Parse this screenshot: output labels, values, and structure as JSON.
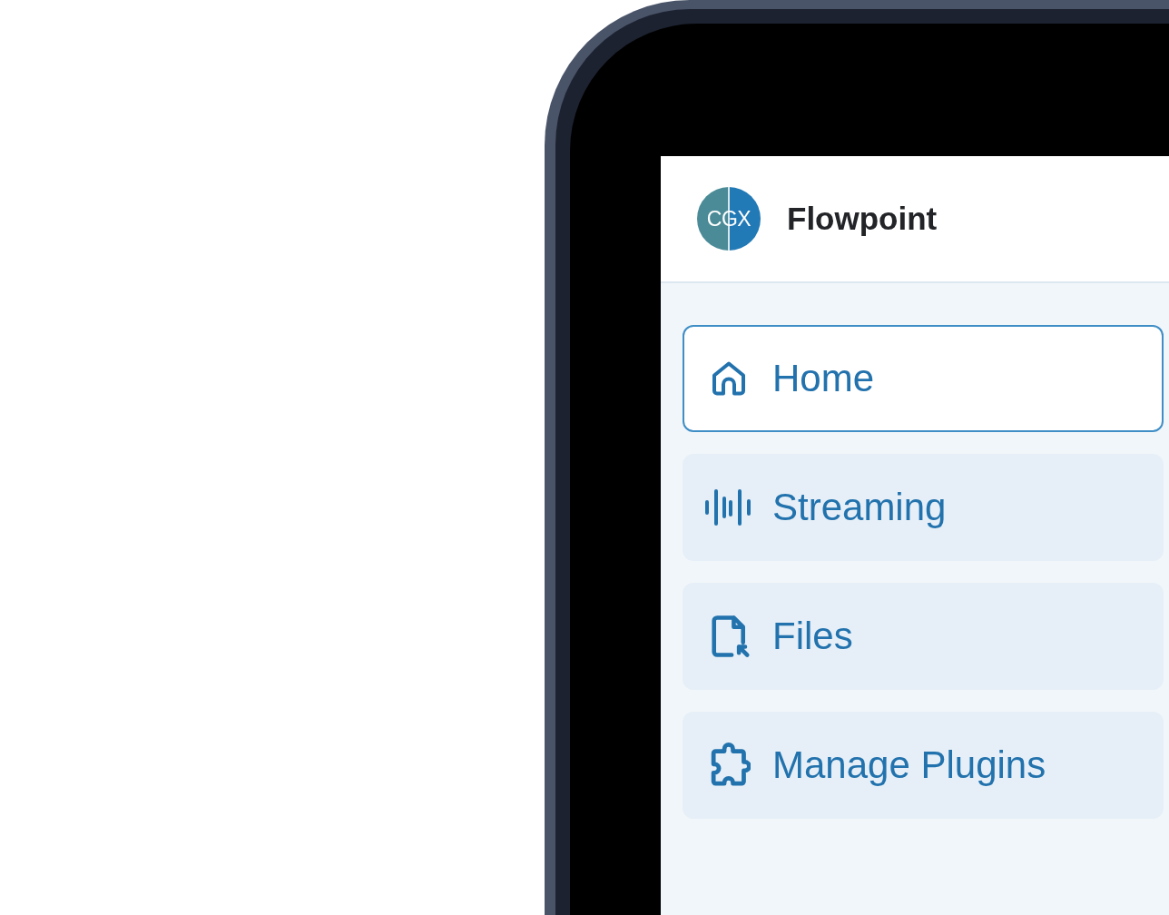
{
  "device": {
    "header": {
      "logo": {
        "text": "CGX"
      },
      "title": "Flowpoint"
    },
    "nav": {
      "items": [
        {
          "label": "Home",
          "selected": true
        },
        {
          "label": "Streaming",
          "selected": false
        },
        {
          "label": "Files",
          "selected": false
        },
        {
          "label": "Manage Plugins",
          "selected": false
        }
      ]
    }
  }
}
